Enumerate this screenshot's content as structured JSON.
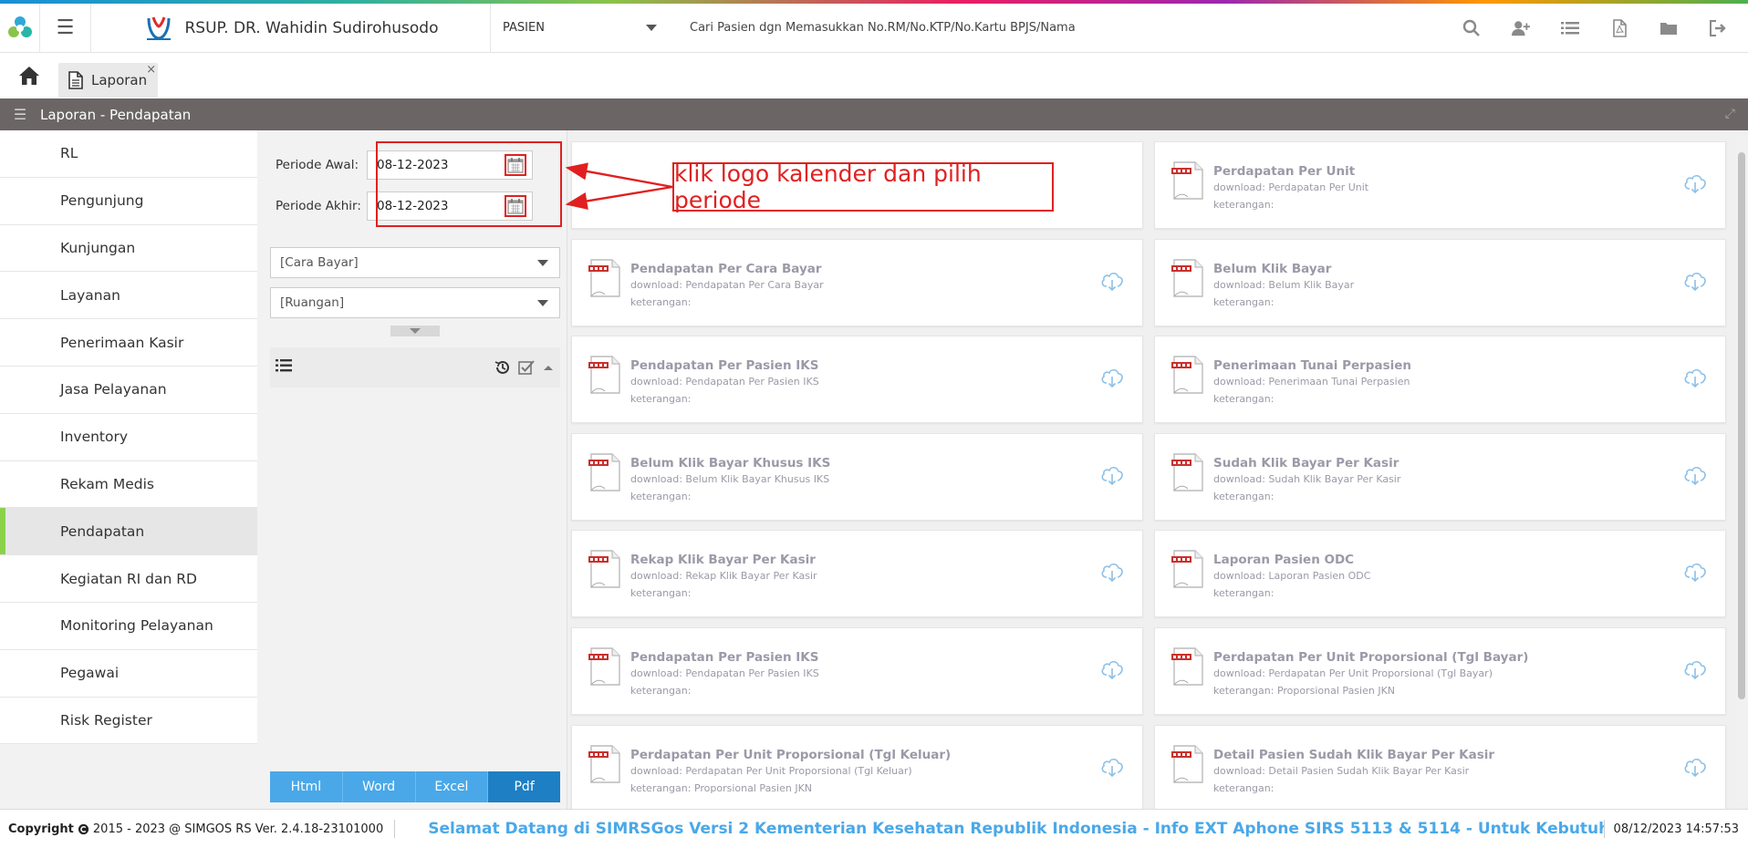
{
  "header": {
    "brand": "RSUP. DR. Wahidin Sudirohusodo",
    "patient_select": "PASIEN",
    "search_placeholder": "Cari Pasien dgn Memasukkan No.RM/No.KTP/No.Kartu BPJS/Nama"
  },
  "tabs": {
    "file_tab": "Laporan",
    "close": "×"
  },
  "titlebar": {
    "title": "Laporan - Pendapatan"
  },
  "sidebar": {
    "items": [
      {
        "label": "RL",
        "active": false
      },
      {
        "label": "Pengunjung",
        "active": false
      },
      {
        "label": "Kunjungan",
        "active": false
      },
      {
        "label": "Layanan",
        "active": false
      },
      {
        "label": "Penerimaan Kasir",
        "active": false
      },
      {
        "label": "Jasa Pelayanan",
        "active": false
      },
      {
        "label": "Inventory",
        "active": false
      },
      {
        "label": "Rekam Medis",
        "active": false
      },
      {
        "label": "Pendapatan",
        "active": true
      },
      {
        "label": "Kegiatan RI dan RD",
        "active": false
      },
      {
        "label": "Monitoring Pelayanan",
        "active": false
      },
      {
        "label": "Pegawai",
        "active": false
      },
      {
        "label": "Risk Register",
        "active": false
      }
    ]
  },
  "filter": {
    "periode_awal_label": "Periode Awal:",
    "periode_awal_value": "08-12-2023",
    "periode_akhir_label": "Periode Akhir:",
    "periode_akhir_value": "08-12-2023",
    "cara_bayar": "[Cara Bayar]",
    "ruangan": "[Ruangan]",
    "export_buttons": [
      "Html",
      "Word",
      "Excel",
      "Pdf"
    ],
    "export_active": "Pdf"
  },
  "annotation": {
    "text": "klik logo kalender dan pilih periode",
    "color": "#e02020"
  },
  "cards": [
    {
      "title": "",
      "download": "",
      "keterangan": ""
    },
    {
      "title": "Perdapatan Per Unit",
      "download": "download: Perdapatan Per Unit",
      "keterangan": "keterangan:"
    },
    {
      "title": "Pendapatan Per Cara Bayar",
      "download": "download: Pendapatan Per Cara Bayar",
      "keterangan": "keterangan:"
    },
    {
      "title": "Belum Klik Bayar",
      "download": "download: Belum Klik Bayar",
      "keterangan": "keterangan:"
    },
    {
      "title": "Pendapatan Per Pasien IKS",
      "download": "download: Pendapatan Per Pasien IKS",
      "keterangan": "keterangan:"
    },
    {
      "title": "Penerimaan Tunai Perpasien",
      "download": "download: Penerimaan Tunai Perpasien",
      "keterangan": "keterangan:"
    },
    {
      "title": "Belum Klik Bayar Khusus IKS",
      "download": "download: Belum Klik Bayar Khusus IKS",
      "keterangan": "keterangan:"
    },
    {
      "title": "Sudah Klik Bayar Per Kasir",
      "download": "download: Sudah Klik Bayar Per Kasir",
      "keterangan": "keterangan:"
    },
    {
      "title": "Rekap Klik Bayar Per Kasir",
      "download": "download: Rekap Klik Bayar Per Kasir",
      "keterangan": "keterangan:"
    },
    {
      "title": "Laporan Pasien ODC",
      "download": "download: Laporan Pasien ODC",
      "keterangan": "keterangan:"
    },
    {
      "title": "Pendapatan Per Pasien IKS",
      "download": "download: Pendapatan Per Pasien IKS",
      "keterangan": "keterangan:"
    },
    {
      "title": "Perdapatan Per Unit Proporsional (Tgl Bayar)",
      "download": "download: Perdapatan Per Unit Proporsional (Tgl Bayar)",
      "keterangan": "keterangan: Proporsional Pasien JKN"
    },
    {
      "title": "Perdapatan Per Unit Proporsional (Tgl Keluar)",
      "download": "download: Perdapatan Per Unit Proporsional (Tgl Keluar)",
      "keterangan": "keterangan: Proporsional Pasien JKN"
    },
    {
      "title": "Detail Pasien Sudah Klik Bayar Per Kasir",
      "download": "download: Detail Pasien Sudah Klik Bayar Per Kasir",
      "keterangan": "keterangan:"
    }
  ],
  "doc_icon_label": "LAPORAN",
  "footer": {
    "copyright": "2015 - 2023 @ SIMGOS RS Ver. 2.4.18-23101000",
    "copyright_prefix": "Copyright",
    "marquee": "Selamat Datang di SIMRSGos Versi 2 Kementerian Kesehatan Republik Indonesia - Info EXT Aphone SIRS 5113 & 5114 - Untuk Kebutuhan Terkait Hal",
    "datetime": "08/12/2023 14:57:53"
  },
  "colors": {
    "accent_green": "#8bd24b",
    "export_blue": "#4aa8e8",
    "export_active": "#1e7fc4",
    "titlebar": "#6b6566"
  }
}
